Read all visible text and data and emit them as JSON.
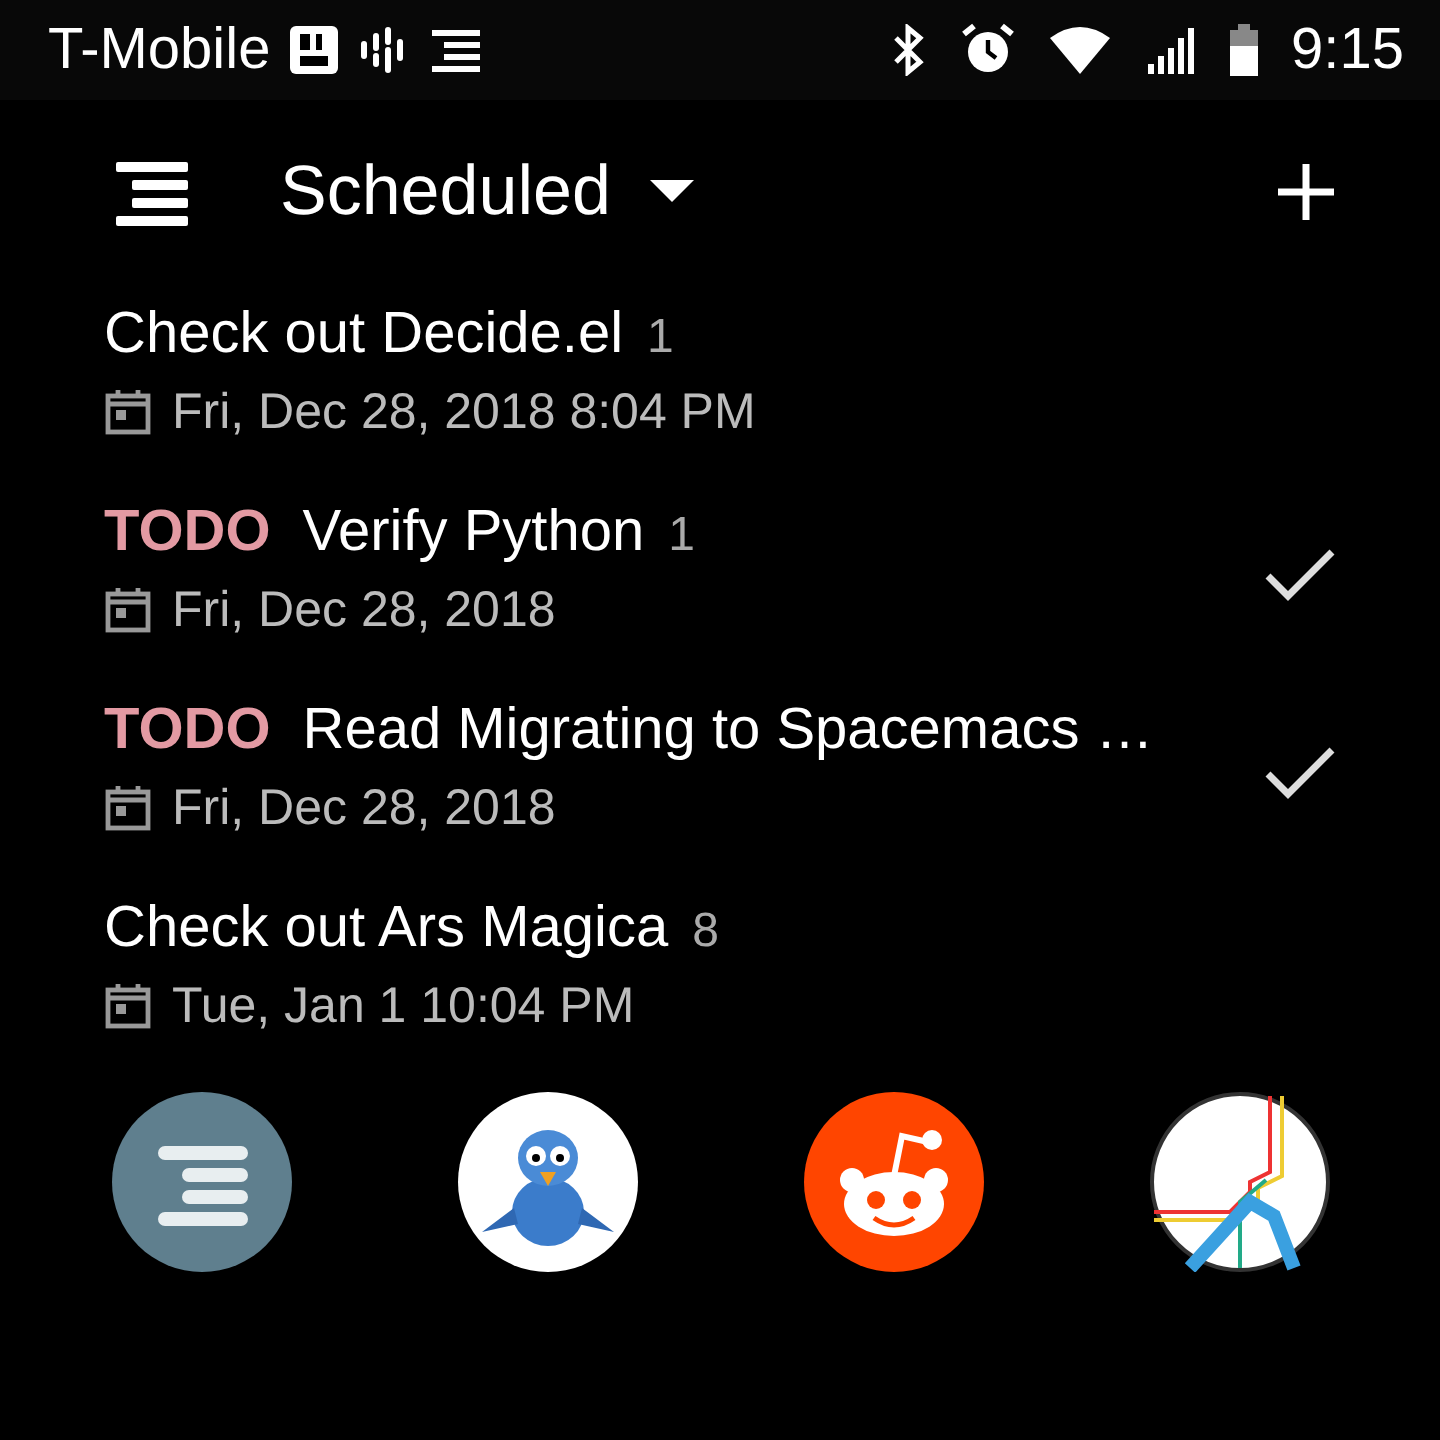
{
  "status_bar": {
    "carrier": "T-Mobile",
    "time": "9:15"
  },
  "toolbar": {
    "title": "Scheduled"
  },
  "items": [
    {
      "title": "Check out Decide.el",
      "count": "1",
      "date": "Fri, Dec 28, 2018 8:04 PM",
      "show_done": false
    },
    {
      "state": "TODO",
      "title": "Verify Python",
      "count": "1",
      "date": "Fri, Dec 28, 2018",
      "show_done": true
    },
    {
      "state": "TODO",
      "title": "Read Migrating to Spacemacs …",
      "date": "Fri, Dec 28, 2018",
      "show_done": true
    },
    {
      "title": "Check out Ars Magica",
      "count": "8",
      "date": "Tue, Jan 1 10:04 PM",
      "show_done": false
    }
  ],
  "dock": [
    {
      "kind": "lines"
    },
    {
      "kind": "bird"
    },
    {
      "kind": "alien"
    },
    {
      "kind": "transit"
    }
  ]
}
